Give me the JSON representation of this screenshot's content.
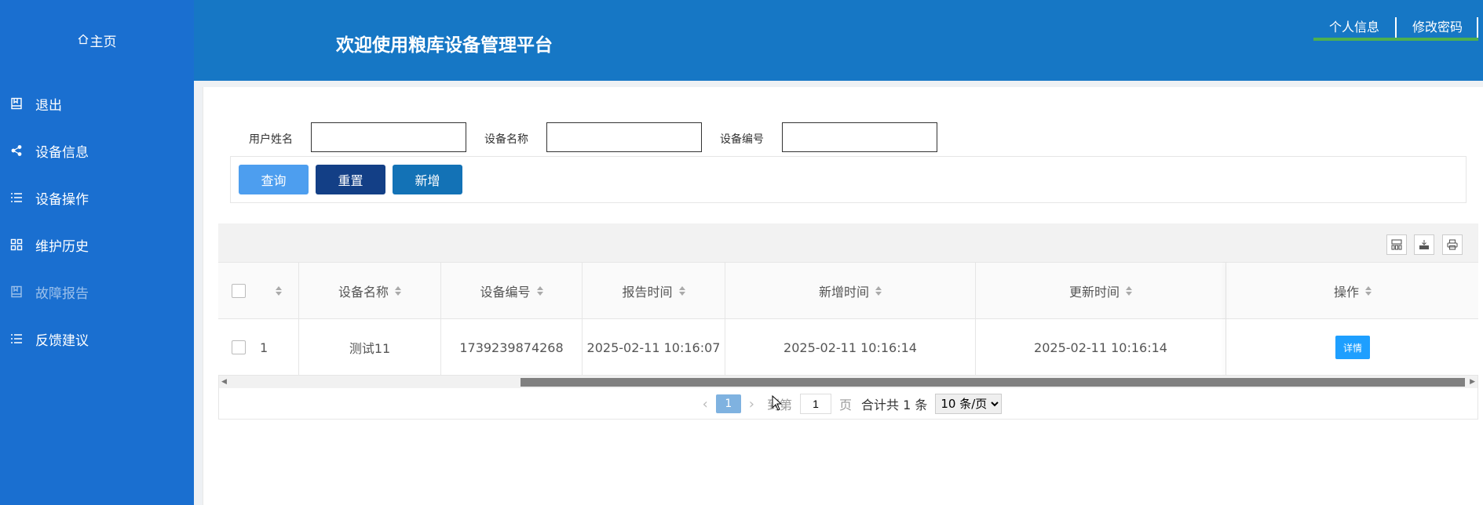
{
  "header": {
    "home_label": "主页",
    "title": "欢迎使用粮库设备管理平台",
    "links": [
      "个人信息",
      "修改密码"
    ]
  },
  "sidebar": {
    "items": [
      {
        "label": "退出",
        "icon": "book-icon"
      },
      {
        "label": "设备信息",
        "icon": "share-icon"
      },
      {
        "label": "设备操作",
        "icon": "list-icon"
      },
      {
        "label": "维护历史",
        "icon": "grid-icon"
      },
      {
        "label": "故障报告",
        "icon": "book-icon",
        "active": true
      },
      {
        "label": "反馈建议",
        "icon": "list-icon"
      }
    ]
  },
  "search": {
    "fields": [
      {
        "label": "用户姓名",
        "value": ""
      },
      {
        "label": "设备名称",
        "value": ""
      },
      {
        "label": "设备编号",
        "value": ""
      }
    ],
    "buttons": {
      "query": "查询",
      "reset": "重置",
      "add": "新增"
    }
  },
  "table": {
    "toolbar_icons": [
      "columns-icon",
      "export-icon",
      "print-icon"
    ],
    "columns": [
      "设备名称",
      "设备编号",
      "报告时间",
      "新增时间",
      "更新时间",
      "操作"
    ],
    "partial_first_cell": "1",
    "rows": [
      {
        "partial": "1",
        "name": "测试11",
        "code": "1739239874268",
        "report_time": "2025-02-11 10:16:07",
        "created_time": "2025-02-11 10:16:14",
        "updated_time": "2025-02-11 10:16:14",
        "action": "详情"
      }
    ]
  },
  "pager": {
    "current_page": "1",
    "goto_prefix": "到第",
    "goto_value": "1",
    "goto_suffix": "页",
    "total": "合计共 1 条",
    "page_size": "10 条/页"
  },
  "colors": {
    "header_bg": "#1677c5",
    "sidebar_bg": "#1a6fd0",
    "btn_query": "#4d9eef",
    "btn_reset": "#133f86",
    "btn_add": "#1372b6",
    "detail_btn": "#1e9fff"
  }
}
